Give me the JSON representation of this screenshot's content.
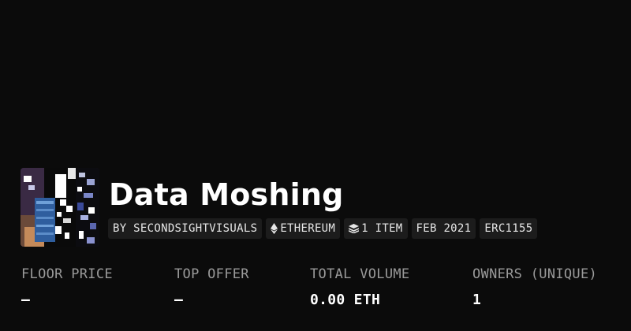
{
  "collection": {
    "title": "Data Moshing",
    "image_icon": "collection-thumbnail"
  },
  "meta": {
    "creator": "BY SECONDSIGHTVISUALS",
    "chain": "ETHEREUM",
    "chain_icon": "ethereum-icon",
    "items": "1 ITEM",
    "items_icon": "layers-icon",
    "date": "FEB 2021",
    "standard": "ERC1155"
  },
  "stats": [
    {
      "label": "FLOOR PRICE",
      "value": "—"
    },
    {
      "label": "TOP OFFER",
      "value": "—"
    },
    {
      "label": "TOTAL VOLUME",
      "value": "0.00 ETH"
    },
    {
      "label": "OWNERS (UNIQUE)",
      "value": "1"
    }
  ],
  "colors": {
    "background": "#0b0b0b",
    "pill_background": "#1c1c1c",
    "label_gray": "#9a9a9a",
    "text_white": "#ffffff"
  }
}
